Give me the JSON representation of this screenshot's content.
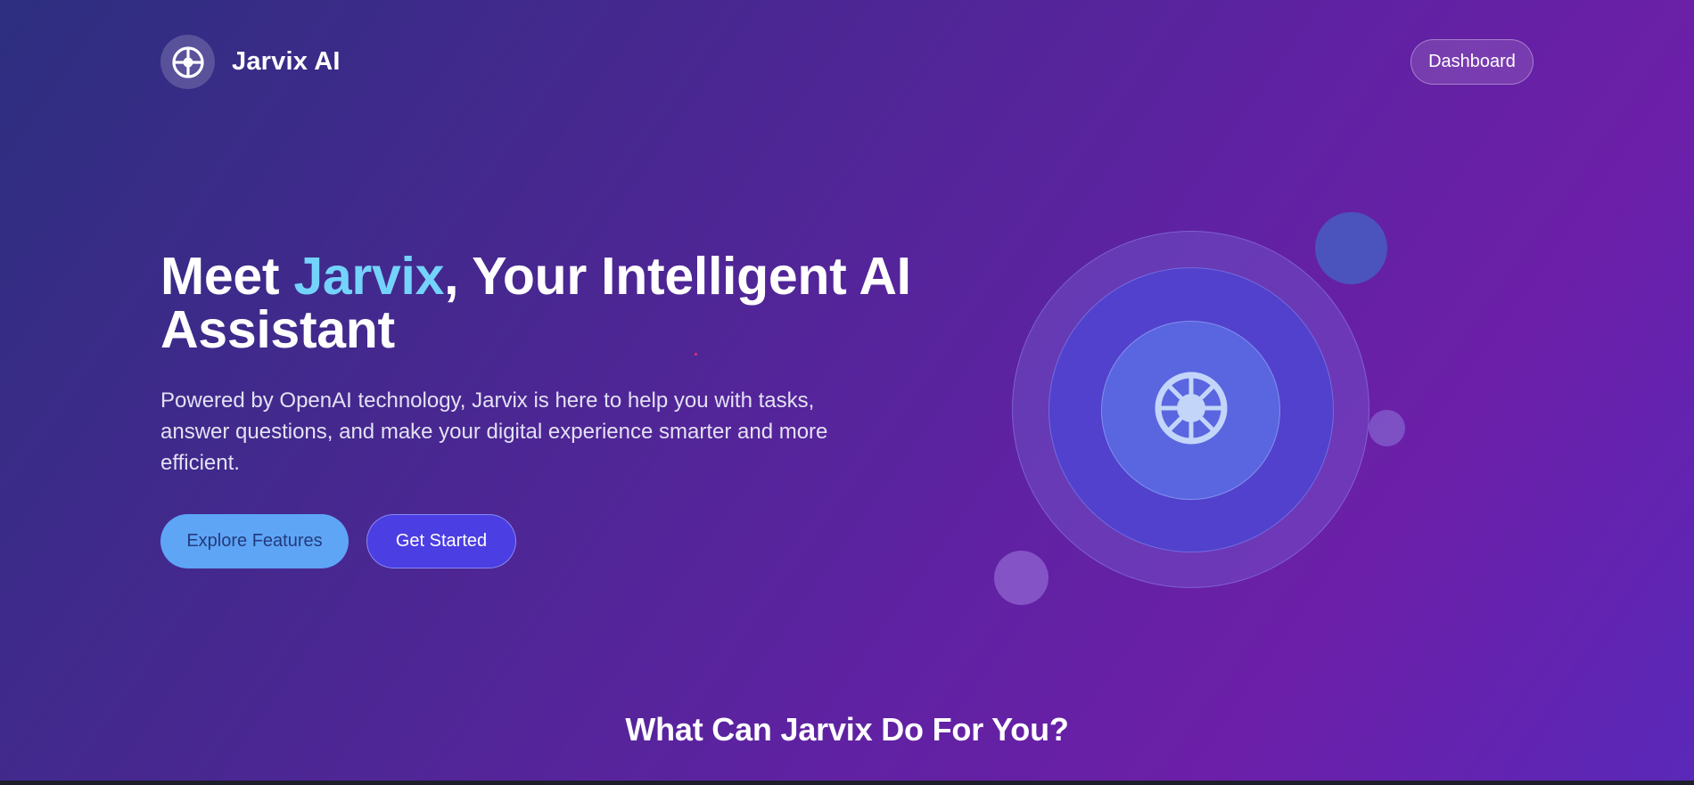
{
  "brand": {
    "name": "Jarvix AI",
    "logo_icon": "crosshair-icon"
  },
  "nav": {
    "dashboard_label": "Dashboard"
  },
  "hero": {
    "title_prefix": "Meet ",
    "title_highlight": "Jarvix",
    "title_suffix": ", Your Intelligent AI Assistant",
    "description": "Powered by OpenAI technology, Jarvix is here to help you with tasks, answer questions, and make your digital experience smarter and more efficient.",
    "primary_button": "Explore Features",
    "secondary_button": "Get Started",
    "illustration_icon": "helm-wheel-icon"
  },
  "features": {
    "heading": "What Can Jarvix Do For You?"
  },
  "colors": {
    "accent_text": "#74d3fb",
    "primary_button_bg": "#5ea5f6",
    "secondary_button_bg": "#4b3ee2",
    "background_start": "#2d2f80",
    "background_end": "#6c1fa8"
  }
}
